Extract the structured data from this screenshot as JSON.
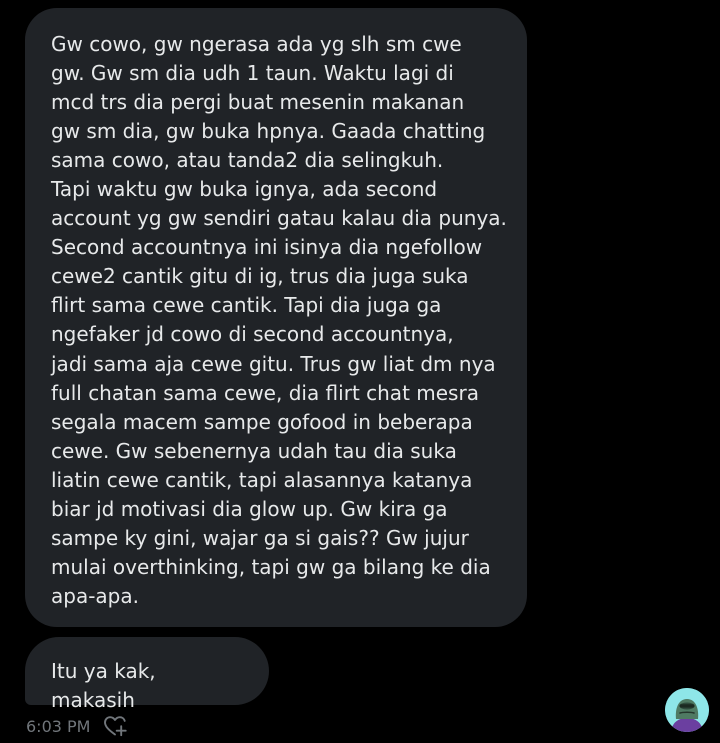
{
  "messages": [
    {
      "text": "Gw cowo, gw ngerasa ada yg slh sm cwe\ngw. Gw sm dia udh 1 taun. Waktu lagi di\nmcd trs dia pergi buat mesenin makanan\ngw sm dia, gw buka hpnya. Gaada chatting\nsama cowo, atau tanda2 dia selingkuh.\nTapi waktu gw buka ignya, ada second\naccount yg gw sendiri gatau kalau dia punya.\nSecond accountnya ini isinya dia ngefollow\ncewe2 cantik gitu di ig, trus dia juga suka\nflirt sama cewe cantik. Tapi dia juga ga\nngefaker jd cowo di second accountnya,\njadi sama aja cewe gitu. Trus gw liat dm nya\nfull chatan sama cewe, dia flirt chat mesra\nsegala macem sampe gofood in beberapa\ncewe. Gw sebenernya udah tau dia suka\nliatin cewe cantik, tapi alasannya katanya\nbiar jd motivasi dia glow up. Gw kira ga\nsampe ky gini, wajar ga si gais?? Gw jujur\nmulai overthinking, tapi gw ga bilang ke dia\napa-apa."
    },
    {
      "text": "Itu ya kak, makasih"
    }
  ],
  "meta": {
    "timestamp": "6:03 PM",
    "react_icon": "heart-plus-icon"
  },
  "avatar": {
    "icon": "avatar-cartoon-icon"
  },
  "colors": {
    "background": "#000000",
    "bubble": "#202327",
    "text": "#e7e9ea",
    "muted": "#71767b"
  }
}
